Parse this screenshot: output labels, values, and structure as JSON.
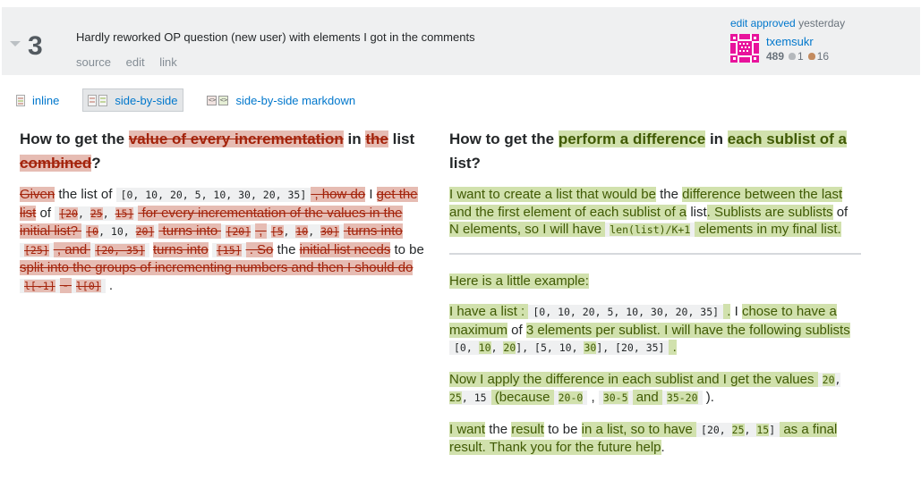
{
  "revision": {
    "number": "3",
    "comment": "Hardly reworked OP question (new user) with elements I got in the comments",
    "links": [
      "source",
      "edit",
      "link"
    ],
    "signature": {
      "action": "edit approved",
      "time": "yesterday",
      "user": "txemsukr",
      "reputation": "489",
      "silver_badges": "1",
      "bronze_badges": "16",
      "avatar_color": "#e8139c"
    }
  },
  "tabs": [
    {
      "label": "inline",
      "icon": "inline-diff-icon",
      "active": false
    },
    {
      "label": "side-by-side",
      "icon": "side-by-side-icon",
      "active": true
    },
    {
      "label": "side-by-side markdown",
      "icon": "markdown-diff-icon",
      "active": false
    }
  ],
  "colors": {
    "deleted_bg": "#e6bcb3",
    "deleted_text": "#a3230b",
    "added_bg": "#d1e1ad",
    "added_text": "#405a04",
    "link": "#0077cc"
  },
  "left": {
    "title": [
      {
        "t": "How to get the "
      },
      {
        "t": "value of every incrementation",
        "del": true
      },
      {
        "t": " in "
      },
      {
        "t": "the",
        "del": true
      },
      {
        "t": " list "
      },
      {
        "t": "combined",
        "del": true
      },
      {
        "t": "?"
      }
    ],
    "body": [
      [
        {
          "t": "Given",
          "del": true
        },
        {
          "t": " the list of "
        },
        {
          "code": [
            {
              "t": "[0, 10, 20, 5, 10, 30, 20, 35]"
            }
          ]
        },
        {
          "t": " , how do",
          "del": true
        },
        {
          "t": " I "
        },
        {
          "t": "get the list",
          "del": true
        },
        {
          "t": " of "
        },
        {
          "code": [
            {
              "t": "[20",
              "del": true
            },
            {
              "t": ", "
            },
            {
              "t": "25",
              "del": true
            },
            {
              "t": ", "
            },
            {
              "t": "15]",
              "del": true
            }
          ]
        },
        {
          "t": " for every incrementation of the values in the initial list? ",
          "del": true
        },
        {
          "code": [
            {
              "t": "[0",
              "del": true
            },
            {
              "t": ", 10, "
            },
            {
              "t": "20]",
              "del": true
            }
          ]
        },
        {
          "t": " turns into ",
          "del": true
        },
        {
          "code": [
            {
              "t": "[20]",
              "del": true
            }
          ]
        },
        {
          "t": " , ",
          "del": true
        },
        {
          "code": [
            {
              "t": "[5",
              "del": true
            },
            {
              "t": ", "
            },
            {
              "t": "10",
              "del": true
            },
            {
              "t": ", "
            },
            {
              "t": "30]",
              "del": true
            }
          ]
        },
        {
          "t": " turns into ",
          "del": true
        },
        {
          "code": [
            {
              "t": "[25]",
              "del": true
            }
          ]
        },
        {
          "t": " , and ",
          "del": true
        },
        {
          "code": [
            {
              "t": "[20, 35]",
              "del": true
            }
          ]
        },
        {
          "t": " "
        },
        {
          "t": "turns into",
          "del": true
        },
        {
          "t": " "
        },
        {
          "code": [
            {
              "t": "[15]",
              "del": true
            }
          ]
        },
        {
          "t": " . So",
          "del": true
        },
        {
          "t": " the "
        },
        {
          "t": "initial list needs",
          "del": true
        },
        {
          "t": " to be "
        },
        {
          "t": "split into the groups of incrementing numbers and then I should do",
          "del": true
        },
        {
          "t": " "
        },
        {
          "code": [
            {
              "t": "l[-1]",
              "del": true
            }
          ]
        },
        {
          "t": " - ",
          "del": true
        },
        {
          "code": [
            {
              "t": "l[0]",
              "del": true
            }
          ]
        },
        {
          "t": " ."
        }
      ]
    ]
  },
  "right": {
    "title": [
      {
        "t": "How to get the "
      },
      {
        "t": "perform a difference",
        "add": true
      },
      {
        "t": " in "
      },
      {
        "t": "each sublist of a",
        "add": true
      },
      {
        "t": " list?"
      }
    ],
    "body_before_hr": [
      [
        {
          "t": "I want to create a list that would be",
          "add": true
        },
        {
          "t": " the "
        },
        {
          "t": "difference between the last and the first element of each sublist of a",
          "add": true
        },
        {
          "t": " list"
        },
        {
          "t": ". Sublists are sublists",
          "add": true
        },
        {
          "t": " of "
        },
        {
          "t": "N elements, so I will have ",
          "add": true
        },
        {
          "code": [
            {
              "t": "len(list)/K+1",
              "add": true
            }
          ]
        },
        {
          "t": " elements in my final list.",
          "add": true
        }
      ]
    ],
    "body_after_hr": [
      [
        {
          "t": "Here is a little example:",
          "add": true
        }
      ],
      [
        {
          "t": "I have a list : ",
          "add": true
        },
        {
          "code": [
            {
              "t": "[0, 10, 20, 5, 10, 30, 20, 35]"
            }
          ]
        },
        {
          "t": " .",
          "add": true
        },
        {
          "t": " I "
        },
        {
          "t": "chose to have a maximum",
          "add": true
        },
        {
          "t": " of "
        },
        {
          "t": "3 elements per sublist. I will have the following sublists ",
          "add": true
        },
        {
          "code": [
            {
              "t": "[0, "
            },
            {
              "t": "10",
              "add": true
            },
            {
              "t": ", "
            },
            {
              "t": "20",
              "add": true
            },
            {
              "t": "], [5, "
            },
            {
              "t": "10, "
            },
            {
              "t": "30",
              "add": true
            },
            {
              "t": "], [20, 35]"
            }
          ]
        },
        {
          "t": " .",
          "add": true
        }
      ],
      [
        {
          "t": "Now I apply the difference in each sublist and I get the values ",
          "add": true
        },
        {
          "code": [
            {
              "t": "20",
              "add": true
            },
            {
              "t": ", "
            },
            {
              "t": "25",
              "add": true
            },
            {
              "t": ", 15"
            }
          ]
        },
        {
          "t": " (because ",
          "add": true
        },
        {
          "code": [
            {
              "t": "20-0",
              "add": true
            }
          ]
        },
        {
          "t": " , "
        },
        {
          "code": [
            {
              "t": "30-5",
              "add": true
            }
          ]
        },
        {
          "t": " and ",
          "add": true
        },
        {
          "code": [
            {
              "t": "35-20",
              "add": true
            }
          ]
        },
        {
          "t": " )."
        }
      ],
      [
        {
          "t": "I want",
          "add": true
        },
        {
          "t": " the "
        },
        {
          "t": "result",
          "add": true
        },
        {
          "t": " to be "
        },
        {
          "t": "in a list, so to have ",
          "add": true
        },
        {
          "code": [
            {
              "t": "[20, "
            },
            {
              "t": "25",
              "add": true
            },
            {
              "t": ", "
            },
            {
              "t": "15",
              "add": true
            },
            {
              "t": "]"
            }
          ]
        },
        {
          "t": " as a final result. Thank you for the future help",
          "add": true
        },
        {
          "t": "."
        }
      ]
    ]
  }
}
